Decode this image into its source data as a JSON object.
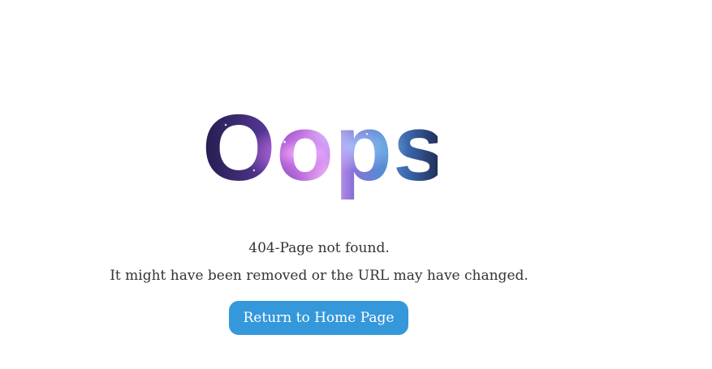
{
  "error": {
    "heading": "Oops!",
    "code_message": "404-Page not found.",
    "detail_message": "It might have been removed or the URL may have changed.",
    "home_button_label": "Return to Home Page"
  },
  "colors": {
    "button_background": "#3498db",
    "button_text": "#ffffff",
    "body_text": "#333333",
    "heading_gradient": [
      "#271c4f",
      "#5b3aa0",
      "#e7b7f3",
      "#4f8fd4",
      "#22305a"
    ]
  }
}
